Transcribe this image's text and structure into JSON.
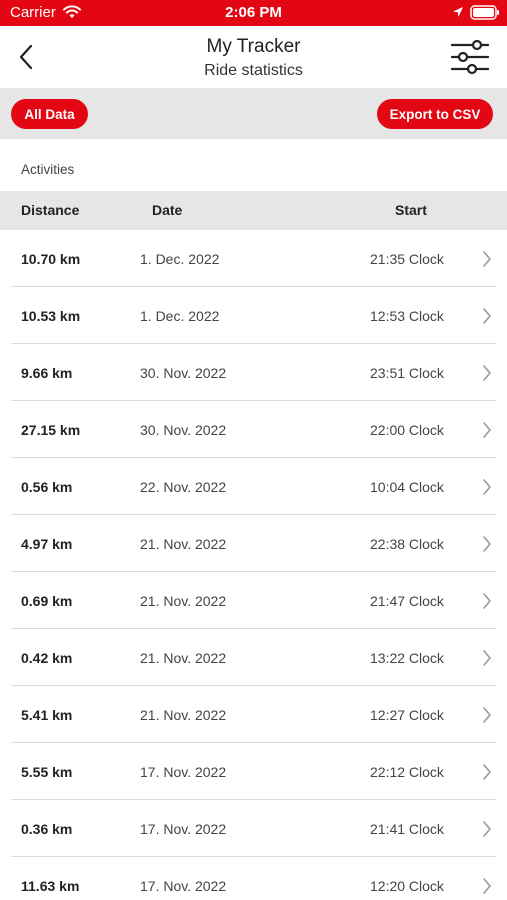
{
  "colors": {
    "accent": "#e30613",
    "band": "#e6e6e6",
    "divider": "#dcdcdc"
  },
  "status_bar": {
    "carrier": "Carrier",
    "time": "2:06 PM",
    "icons": [
      "wifi-icon",
      "location-icon",
      "battery-icon"
    ]
  },
  "nav": {
    "title": "My Tracker",
    "subtitle": "Ride statistics",
    "icons": [
      "chevron-left-icon",
      "sliders-icon"
    ]
  },
  "actions": {
    "all_data_label": "All Data",
    "export_label": "Export to CSV"
  },
  "section_label": "Activities",
  "table": {
    "headers": {
      "distance": "Distance",
      "date": "Date",
      "start": "Start"
    },
    "rows": [
      {
        "distance": "10.70 km",
        "date": "1. Dec. 2022",
        "start": "21:35 Clock"
      },
      {
        "distance": "10.53 km",
        "date": "1. Dec. 2022",
        "start": "12:53 Clock"
      },
      {
        "distance": "9.66 km",
        "date": "30. Nov. 2022",
        "start": "23:51 Clock"
      },
      {
        "distance": "27.15 km",
        "date": "30. Nov. 2022",
        "start": "22:00 Clock"
      },
      {
        "distance": "0.56 km",
        "date": "22. Nov. 2022",
        "start": "10:04 Clock"
      },
      {
        "distance": "4.97 km",
        "date": "21. Nov. 2022",
        "start": "22:38 Clock"
      },
      {
        "distance": "0.69 km",
        "date": "21. Nov. 2022",
        "start": "21:47 Clock"
      },
      {
        "distance": "0.42 km",
        "date": "21. Nov. 2022",
        "start": "13:22 Clock"
      },
      {
        "distance": "5.41 km",
        "date": "21. Nov. 2022",
        "start": "12:27 Clock"
      },
      {
        "distance": "5.55 km",
        "date": "17. Nov. 2022",
        "start": "22:12 Clock"
      },
      {
        "distance": "0.36 km",
        "date": "17. Nov. 2022",
        "start": "21:41 Clock"
      },
      {
        "distance": "11.63 km",
        "date": "17. Nov. 2022",
        "start": "12:20 Clock"
      }
    ]
  }
}
